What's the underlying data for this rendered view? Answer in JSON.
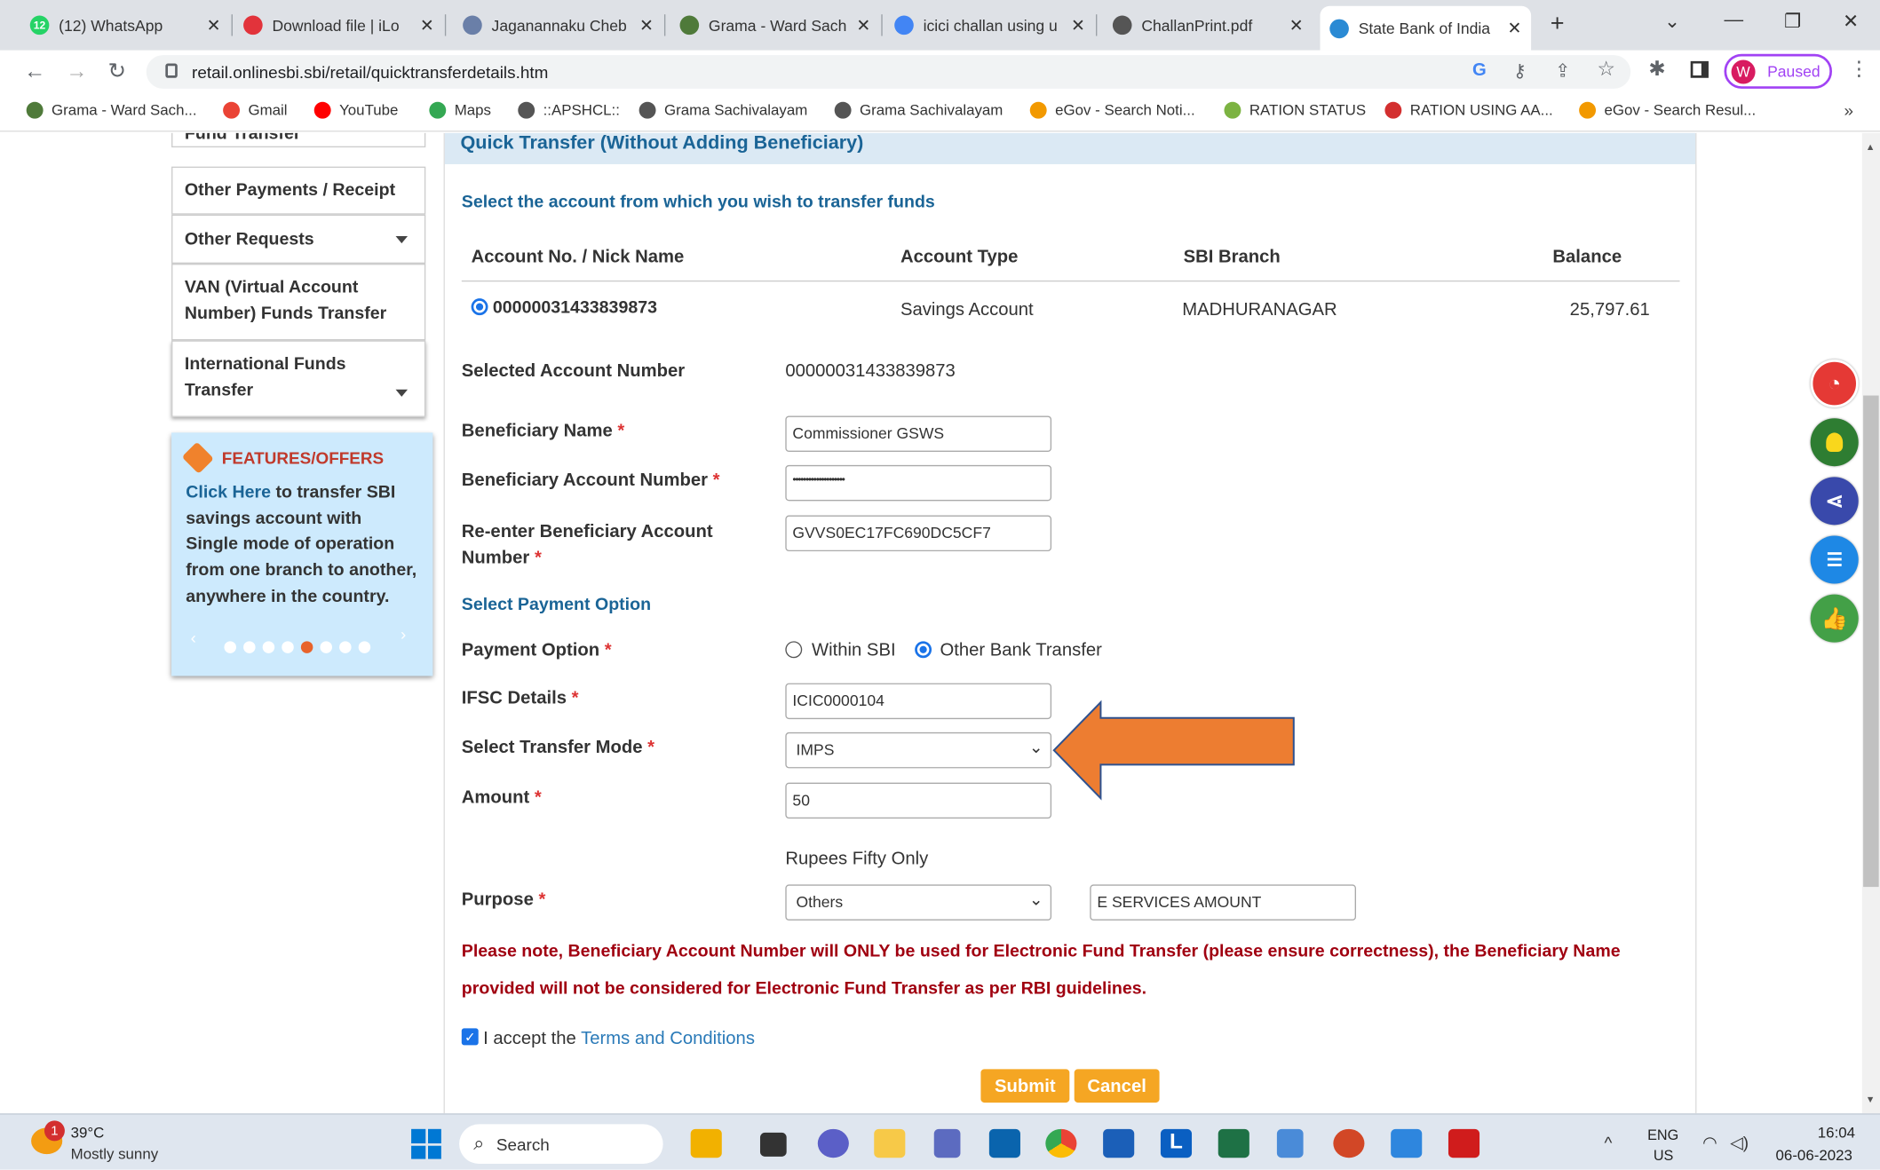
{
  "browser": {
    "tabs": [
      {
        "label": "(12) WhatsApp",
        "badge": "12",
        "color": "#25d366"
      },
      {
        "label": "Download file | iLo",
        "color": "#e2333b"
      },
      {
        "label": "Jaganannaku Cheb",
        "color": "#6a7fa8"
      },
      {
        "label": "Grama - Ward Sach",
        "color": "#4f7a3a"
      },
      {
        "label": "icici challan using u",
        "color": "#4285f4"
      },
      {
        "label": "ChallanPrint.pdf",
        "color": "#555555"
      },
      {
        "label": "State Bank of India",
        "color": "#2a8ad4"
      }
    ],
    "new_tab": "+",
    "url": "retail.onlinesbi.sbi/retail/quicktransferdetails.htm",
    "profile_initial": "W",
    "profile_status": "Paused",
    "bookmarks": [
      {
        "label": "Grama - Ward Sach...",
        "color": "#4f7a3a"
      },
      {
        "label": "Gmail",
        "color": "#ea4335"
      },
      {
        "label": "YouTube",
        "color": "#ff0000"
      },
      {
        "label": "Maps",
        "color": "#34a853"
      },
      {
        "label": "::APSHCL::",
        "color": "#555555"
      },
      {
        "label": "Grama Sachivalayam",
        "color": "#555555"
      },
      {
        "label": "Grama Sachivalayam",
        "color": "#555555"
      },
      {
        "label": "eGov - Search Noti...",
        "color": "#f29900"
      },
      {
        "label": "RATION STATUS",
        "color": "#7cb342"
      },
      {
        "label": "RATION USING AA...",
        "color": "#d32f2f"
      },
      {
        "label": "eGov - Search Resul...",
        "color": "#f29900"
      }
    ],
    "bookmarks_more": "»"
  },
  "sidebar": {
    "items": [
      {
        "label": "Fund Transfer",
        "has_caret": true
      },
      {
        "label": "Other Payments / Receipt",
        "has_caret": true
      },
      {
        "label": "Other Requests",
        "has_caret": true
      },
      {
        "label": "VAN (Virtual Account Number) Funds Transfer",
        "has_caret": false
      },
      {
        "label": "International Funds Transfer",
        "has_caret": true
      }
    ],
    "features": {
      "title": "FEATURES/OFFERS",
      "link": "Click Here",
      "text": " to transfer SBI savings account with Single mode of operation from one branch to another, anywhere in the country.",
      "active_dot": 4,
      "dot_count": 8
    }
  },
  "form": {
    "section_title": "Quick Transfer (Without Adding Beneficiary)",
    "select_account_text": "Select the account from which you wish to transfer funds",
    "table": {
      "headers": [
        "Account No. / Nick Name",
        "Account Type",
        "SBI Branch",
        "Balance"
      ],
      "row": {
        "account": "00000031433839873",
        "type": "Savings Account",
        "branch": "MADHURANAGAR",
        "balance": "25,797.61"
      }
    },
    "selected_account_label": "Selected Account Number",
    "selected_account_value": "00000031433839873",
    "beneficiary_name_label": "Beneficiary Name",
    "beneficiary_name_value": "Commissioner GSWS",
    "beneficiary_account_label": "Beneficiary Account Number",
    "beneficiary_account_value": "••••••••••••••••••••",
    "reenter_label_1": "Re-enter Beneficiary Account",
    "reenter_label_2": "Number",
    "reenter_value": "GVVS0EC17FC690DC5CF7",
    "payment_option_heading": "Select Payment Option",
    "payment_option_label": "Payment Option",
    "payment_options": [
      "Within SBI",
      "Other Bank Transfer"
    ],
    "payment_selected": "Other Bank Transfer",
    "ifsc_label": "IFSC Details",
    "ifsc_value": "ICIC0000104",
    "transfer_mode_label": "Select Transfer Mode",
    "transfer_mode_value": "IMPS",
    "amount_label": "Amount",
    "amount_value": "50",
    "amount_words": "Rupees Fifty Only",
    "purpose_label": "Purpose",
    "purpose_value": "Others",
    "purpose_remark": "E SERVICES AMOUNT",
    "note_line1": "Please note, Beneficiary Account Number will ONLY be used for Electronic Fund Transfer (please ensure correctness), the Beneficiary Name",
    "note_line2": "provided will not be considered for Electronic Fund Transfer as per RBI guidelines.",
    "accept_text": "I accept the ",
    "accept_link": "Terms and Conditions",
    "accept_checked": true,
    "submit_label": "Submit",
    "cancel_label": "Cancel",
    "required_mark": "*"
  },
  "float_icons": [
    {
      "name": "history",
      "color": "#e53935"
    },
    {
      "name": "bulb",
      "color": "#2e7d32"
    },
    {
      "name": "share",
      "color": "#3949ab"
    },
    {
      "name": "profile-list",
      "color": "#1e88e5"
    },
    {
      "name": "thumbs-up",
      "color": "#43a047"
    }
  ],
  "taskbar": {
    "weather_temp": "39°C",
    "weather_desc": "Mostly sunny",
    "weather_badge": "1",
    "search_placeholder": "Search",
    "lang": "ENG",
    "region": "US",
    "time": "16:04",
    "date": "06-06-2023"
  },
  "colors": {
    "accent": "#1a6496",
    "orange": "#f5a623",
    "arrow": "#ed7d31",
    "note_red": "#a00010"
  }
}
